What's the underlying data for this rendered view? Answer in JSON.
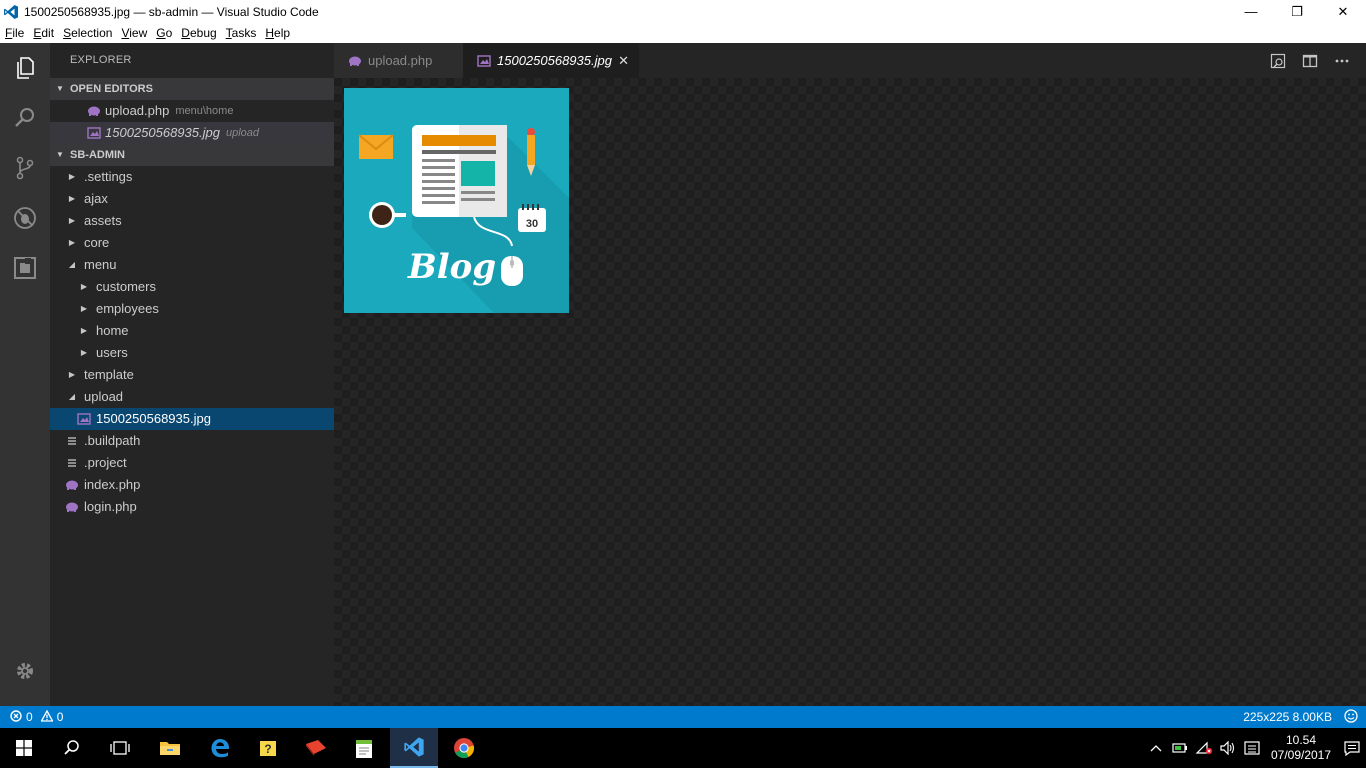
{
  "window": {
    "title": "1500250568935.jpg — sb-admin — Visual Studio Code",
    "minimize": "—",
    "maximize": "❐",
    "close": "✕"
  },
  "menu": [
    {
      "label": "File",
      "ul": "F",
      "rest": "ile"
    },
    {
      "label": "Edit",
      "ul": "E",
      "rest": "dit"
    },
    {
      "label": "Selection",
      "ul": "S",
      "rest": "election"
    },
    {
      "label": "View",
      "ul": "V",
      "rest": "iew"
    },
    {
      "label": "Go",
      "ul": "G",
      "rest": "o"
    },
    {
      "label": "Debug",
      "ul": "D",
      "rest": "ebug"
    },
    {
      "label": "Tasks",
      "ul": "T",
      "rest": "asks"
    },
    {
      "label": "Help",
      "ul": "H",
      "rest": "elp"
    }
  ],
  "activity": [
    "explorer-icon",
    "search-icon",
    "source-control-icon",
    "debug-icon",
    "extensions-icon",
    "settings-gear-icon"
  ],
  "sidebar": {
    "title": "EXPLORER",
    "open_editors": {
      "header": "OPEN EDITORS",
      "items": [
        {
          "label": "upload.php",
          "desc": "menu\\home",
          "icon": "php-icon"
        },
        {
          "label": "1500250568935.jpg",
          "desc": "upload",
          "icon": "image-icon"
        }
      ]
    },
    "project": {
      "header": "SB-ADMIN",
      "tree": [
        {
          "label": ".settings",
          "type": "folder",
          "expanded": false,
          "depth": 0
        },
        {
          "label": "ajax",
          "type": "folder",
          "expanded": false,
          "depth": 0
        },
        {
          "label": "assets",
          "type": "folder",
          "expanded": false,
          "depth": 0
        },
        {
          "label": "core",
          "type": "folder",
          "expanded": false,
          "depth": 0
        },
        {
          "label": "menu",
          "type": "folder",
          "expanded": true,
          "depth": 0
        },
        {
          "label": "customers",
          "type": "folder",
          "expanded": false,
          "depth": 1
        },
        {
          "label": "employees",
          "type": "folder",
          "expanded": false,
          "depth": 1
        },
        {
          "label": "home",
          "type": "folder",
          "expanded": false,
          "depth": 1
        },
        {
          "label": "users",
          "type": "folder",
          "expanded": false,
          "depth": 1
        },
        {
          "label": "template",
          "type": "folder",
          "expanded": false,
          "depth": 0
        },
        {
          "label": "upload",
          "type": "folder",
          "expanded": true,
          "depth": 0
        },
        {
          "label": "1500250568935.jpg",
          "type": "image",
          "depth": 1,
          "selected": true
        },
        {
          "label": ".buildpath",
          "type": "text",
          "depth": 0
        },
        {
          "label": ".project",
          "type": "text",
          "depth": 0
        },
        {
          "label": "index.php",
          "type": "php",
          "depth": 0
        },
        {
          "label": "login.php",
          "type": "php",
          "depth": 0
        }
      ]
    }
  },
  "tabs": [
    {
      "label": "upload.php",
      "icon": "php-icon",
      "active": false
    },
    {
      "label": "1500250568935.jpg",
      "icon": "image-icon",
      "active": true,
      "close": "✕"
    }
  ],
  "editor_actions": [
    "open-preview-icon",
    "split-editor-icon",
    "more-actions-icon"
  ],
  "preview": {
    "image_text": "Blog",
    "calendar_number": "30"
  },
  "status": {
    "errors": "0",
    "warnings": "0",
    "image_info": "225x225 8.00KB"
  },
  "taskbar": {
    "time": "10.54",
    "date": "07/09/2017"
  },
  "colors": {
    "accent": "#007acc",
    "selection": "#094771",
    "php_icon": "#a074c4",
    "preview_bg": "#1aa9bd"
  }
}
